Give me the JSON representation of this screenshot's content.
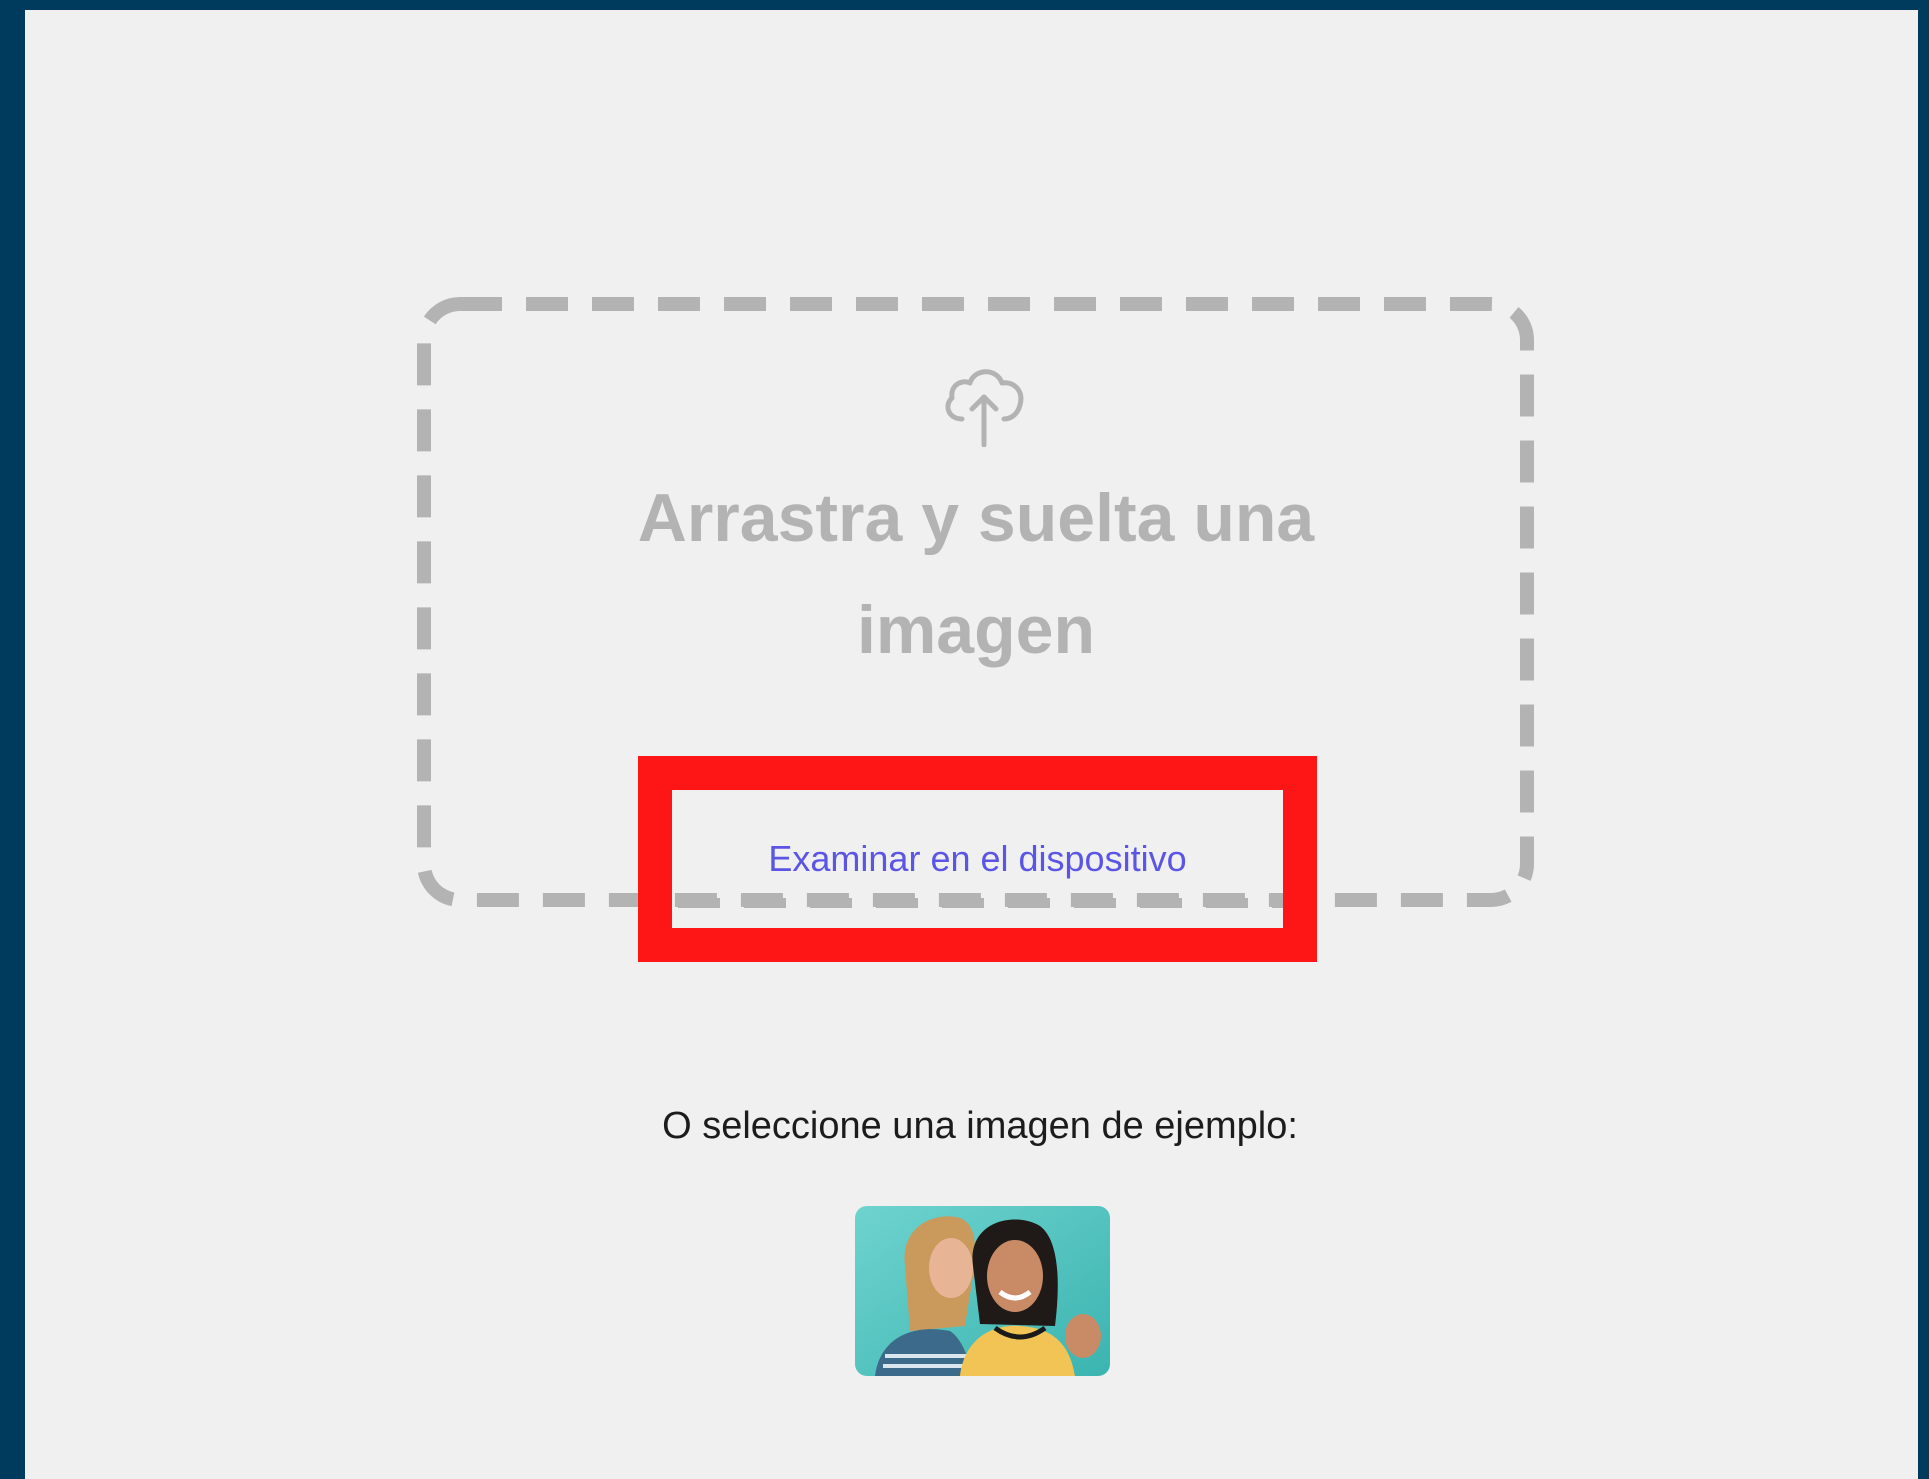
{
  "upload": {
    "icon": "cloud-upload-icon",
    "title_line1": "Arrastra y suelta una",
    "title_line2": "imagen",
    "browse_label": "Examinar en el dispositivo"
  },
  "samples": {
    "label": "O seleccione una imagen de ejemplo:",
    "items": [
      {
        "description_icon": "sample-photo-two-women"
      }
    ]
  },
  "colors": {
    "frame": "#003a5c",
    "panel": "#f0f0f0",
    "dashed_border": "#b3b3b3",
    "highlight": "#fe1616",
    "link": "#5b55e6"
  }
}
